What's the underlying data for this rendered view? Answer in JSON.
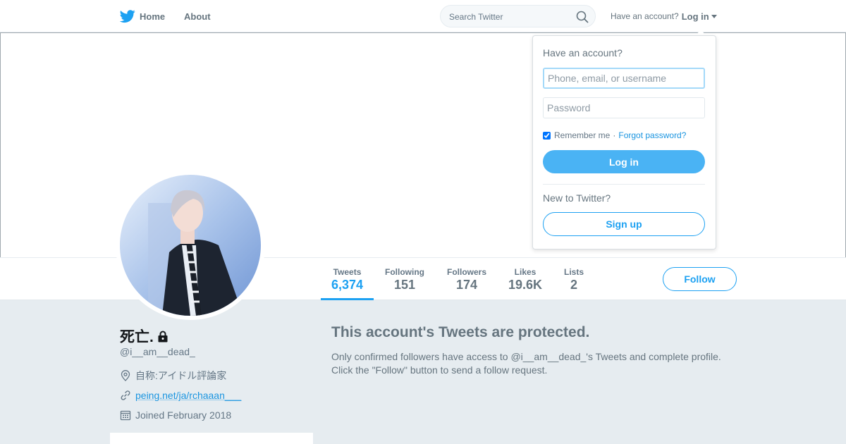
{
  "nav": {
    "home_label": "Home",
    "about_label": "About",
    "search_placeholder": "Search Twitter",
    "account_prompt": "Have an account?",
    "login_label": "Log in"
  },
  "login_dropdown": {
    "heading": "Have an account?",
    "username_placeholder": "Phone, email, or username",
    "password_placeholder": "Password",
    "remember_label": "Remember me",
    "separator": "·",
    "forgot_label": "Forgot password?",
    "login_button": "Log in",
    "new_heading": "New to Twitter?",
    "signup_button": "Sign up"
  },
  "stats": [
    {
      "label": "Tweets",
      "value": "6,374"
    },
    {
      "label": "Following",
      "value": "151"
    },
    {
      "label": "Followers",
      "value": "174"
    },
    {
      "label": "Likes",
      "value": "19.6K"
    },
    {
      "label": "Lists",
      "value": "2"
    }
  ],
  "follow_button": "Follow",
  "profile": {
    "name": "死亡.",
    "handle": "@i__am__dead_",
    "location": "自称:アイドル評論家",
    "website": "peing.net/ja/rchaaan___",
    "joined": "Joined February 2018"
  },
  "protected": {
    "title": "This account's Tweets are protected.",
    "line1": "Only confirmed followers have access to @i__am__dead_'s Tweets and complete profile.",
    "line2": "Click the \"Follow\" button to send a follow request."
  },
  "colors": {
    "accent": "#1da1f2",
    "login_button": "#4ab3f4",
    "background": "#e6ecf0",
    "muted_text": "#657786"
  },
  "icons": [
    "twitter-bird-icon",
    "search-icon",
    "caret-down-icon",
    "lock-icon",
    "location-icon",
    "link-icon",
    "calendar-icon"
  ]
}
